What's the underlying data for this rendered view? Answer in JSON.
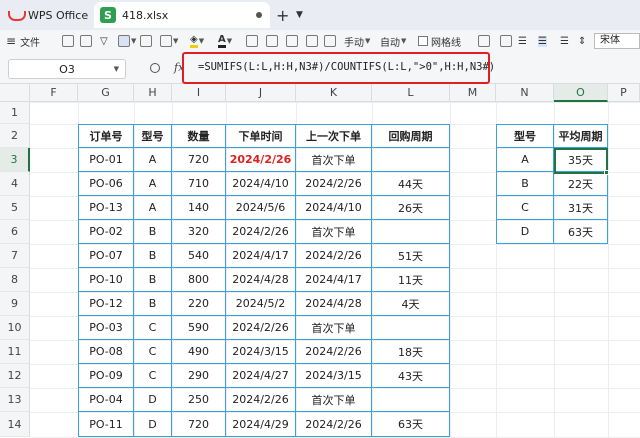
{
  "app": {
    "name": "WPS Office",
    "file_tab": "418.xlsx"
  },
  "toolbar": {
    "file_label": "文件",
    "manual_label": "手动",
    "auto_label": "自动",
    "gridlines_label": "网格线",
    "font_name": "宋体"
  },
  "formula_bar": {
    "cell_ref": "O3",
    "fx": "fx",
    "formula": "=SUMIFS(L:L,H:H,N3#)/COUNTIFS(L:L,\">0\",H:H,N3#)"
  },
  "columns": [
    "F",
    "G",
    "H",
    "I",
    "J",
    "K",
    "L",
    "M",
    "N",
    "O",
    "P"
  ],
  "rows": [
    "1",
    "2",
    "3",
    "4",
    "5",
    "6",
    "7",
    "8",
    "9",
    "10",
    "11",
    "12",
    "13",
    "14"
  ],
  "orders": {
    "headers": [
      "订单号",
      "型号",
      "数量",
      "下单时间",
      "上一次下单",
      "回购周期"
    ],
    "rows": [
      [
        "PO-01",
        "A",
        "720",
        "2024/2/26",
        "首次下单",
        ""
      ],
      [
        "PO-06",
        "A",
        "710",
        "2024/4/10",
        "2024/2/26",
        "44天"
      ],
      [
        "PO-13",
        "A",
        "140",
        "2024/5/6",
        "2024/4/10",
        "26天"
      ],
      [
        "PO-02",
        "B",
        "320",
        "2024/2/26",
        "首次下单",
        ""
      ],
      [
        "PO-07",
        "B",
        "540",
        "2024/4/17",
        "2024/2/26",
        "51天"
      ],
      [
        "PO-10",
        "B",
        "800",
        "2024/4/28",
        "2024/4/17",
        "11天"
      ],
      [
        "PO-12",
        "B",
        "220",
        "2024/5/2",
        "2024/4/28",
        "4天"
      ],
      [
        "PO-03",
        "C",
        "590",
        "2024/2/26",
        "首次下单",
        ""
      ],
      [
        "PO-08",
        "C",
        "490",
        "2024/3/15",
        "2024/2/26",
        "18天"
      ],
      [
        "PO-09",
        "C",
        "290",
        "2024/4/27",
        "2024/3/15",
        "43天"
      ],
      [
        "PO-04",
        "D",
        "250",
        "2024/2/26",
        "首次下单",
        ""
      ],
      [
        "PO-11",
        "D",
        "720",
        "2024/4/29",
        "2024/2/26",
        "63天"
      ]
    ]
  },
  "summary": {
    "headers": [
      "型号",
      "平均周期"
    ],
    "rows": [
      [
        "A",
        "35天"
      ],
      [
        "B",
        "22天"
      ],
      [
        "C",
        "31天"
      ],
      [
        "D",
        "63天"
      ]
    ]
  }
}
